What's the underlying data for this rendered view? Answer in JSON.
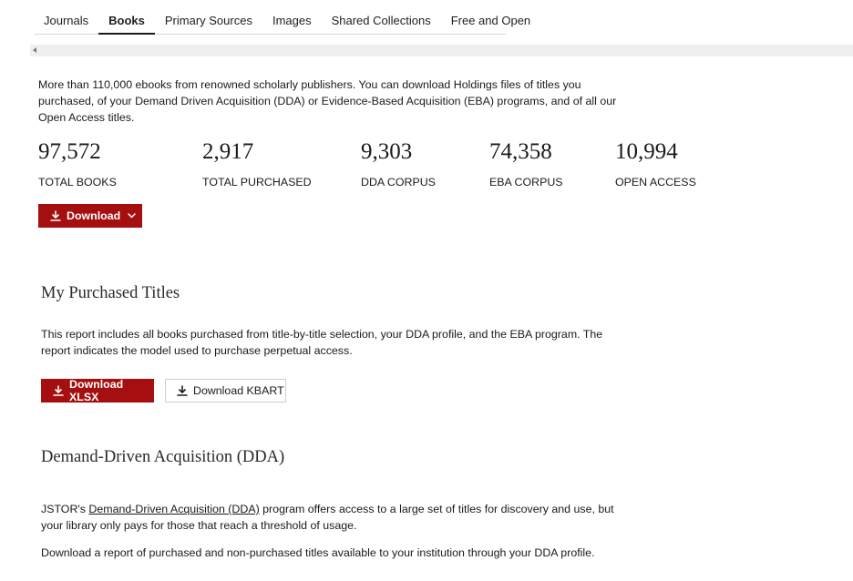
{
  "tabs": [
    {
      "label": "Journals",
      "active": false
    },
    {
      "label": "Books",
      "active": true
    },
    {
      "label": "Primary Sources",
      "active": false
    },
    {
      "label": "Images",
      "active": false
    },
    {
      "label": "Shared Collections",
      "active": false
    },
    {
      "label": "Free and Open",
      "active": false
    }
  ],
  "intro": "More than 110,000 ebooks from renowned scholarly publishers. You can download Holdings files of titles you purchased, of your Demand Driven Acquisition (DDA) or Evidence-Based Acquisition (EBA) programs, and of all our Open Access titles.",
  "stats": [
    {
      "value": "97,572",
      "label": "TOTAL BOOKS"
    },
    {
      "value": "2,917",
      "label": "TOTAL PURCHASED"
    },
    {
      "value": "9,303",
      "label": "DDA CORPUS"
    },
    {
      "value": "74,358",
      "label": "EBA CORPUS"
    },
    {
      "value": "10,994",
      "label": "OPEN ACCESS"
    }
  ],
  "download_button": "Download",
  "purchased": {
    "title": "My Purchased Titles",
    "description": "This report includes all books purchased from title-by-title selection, your DDA profile, and the EBA program. The report indicates the model used to purchase perpetual access.",
    "xlsx_button": "Download XLSX",
    "kbart_button": "Download KBART"
  },
  "dda": {
    "title": "Demand-Driven Acquisition (DDA)",
    "desc_prefix": "JSTOR's ",
    "desc_link": "Demand-Driven Acquisition (DDA)",
    "desc_suffix": " program offers access to a large set of titles for discovery and use, but your library only pays for those that reach a threshold of usage.",
    "download_note": "Download a report of purchased and non-purchased titles available to your institution through your DDA profile."
  },
  "colors": {
    "accent": "#a50f0f"
  }
}
